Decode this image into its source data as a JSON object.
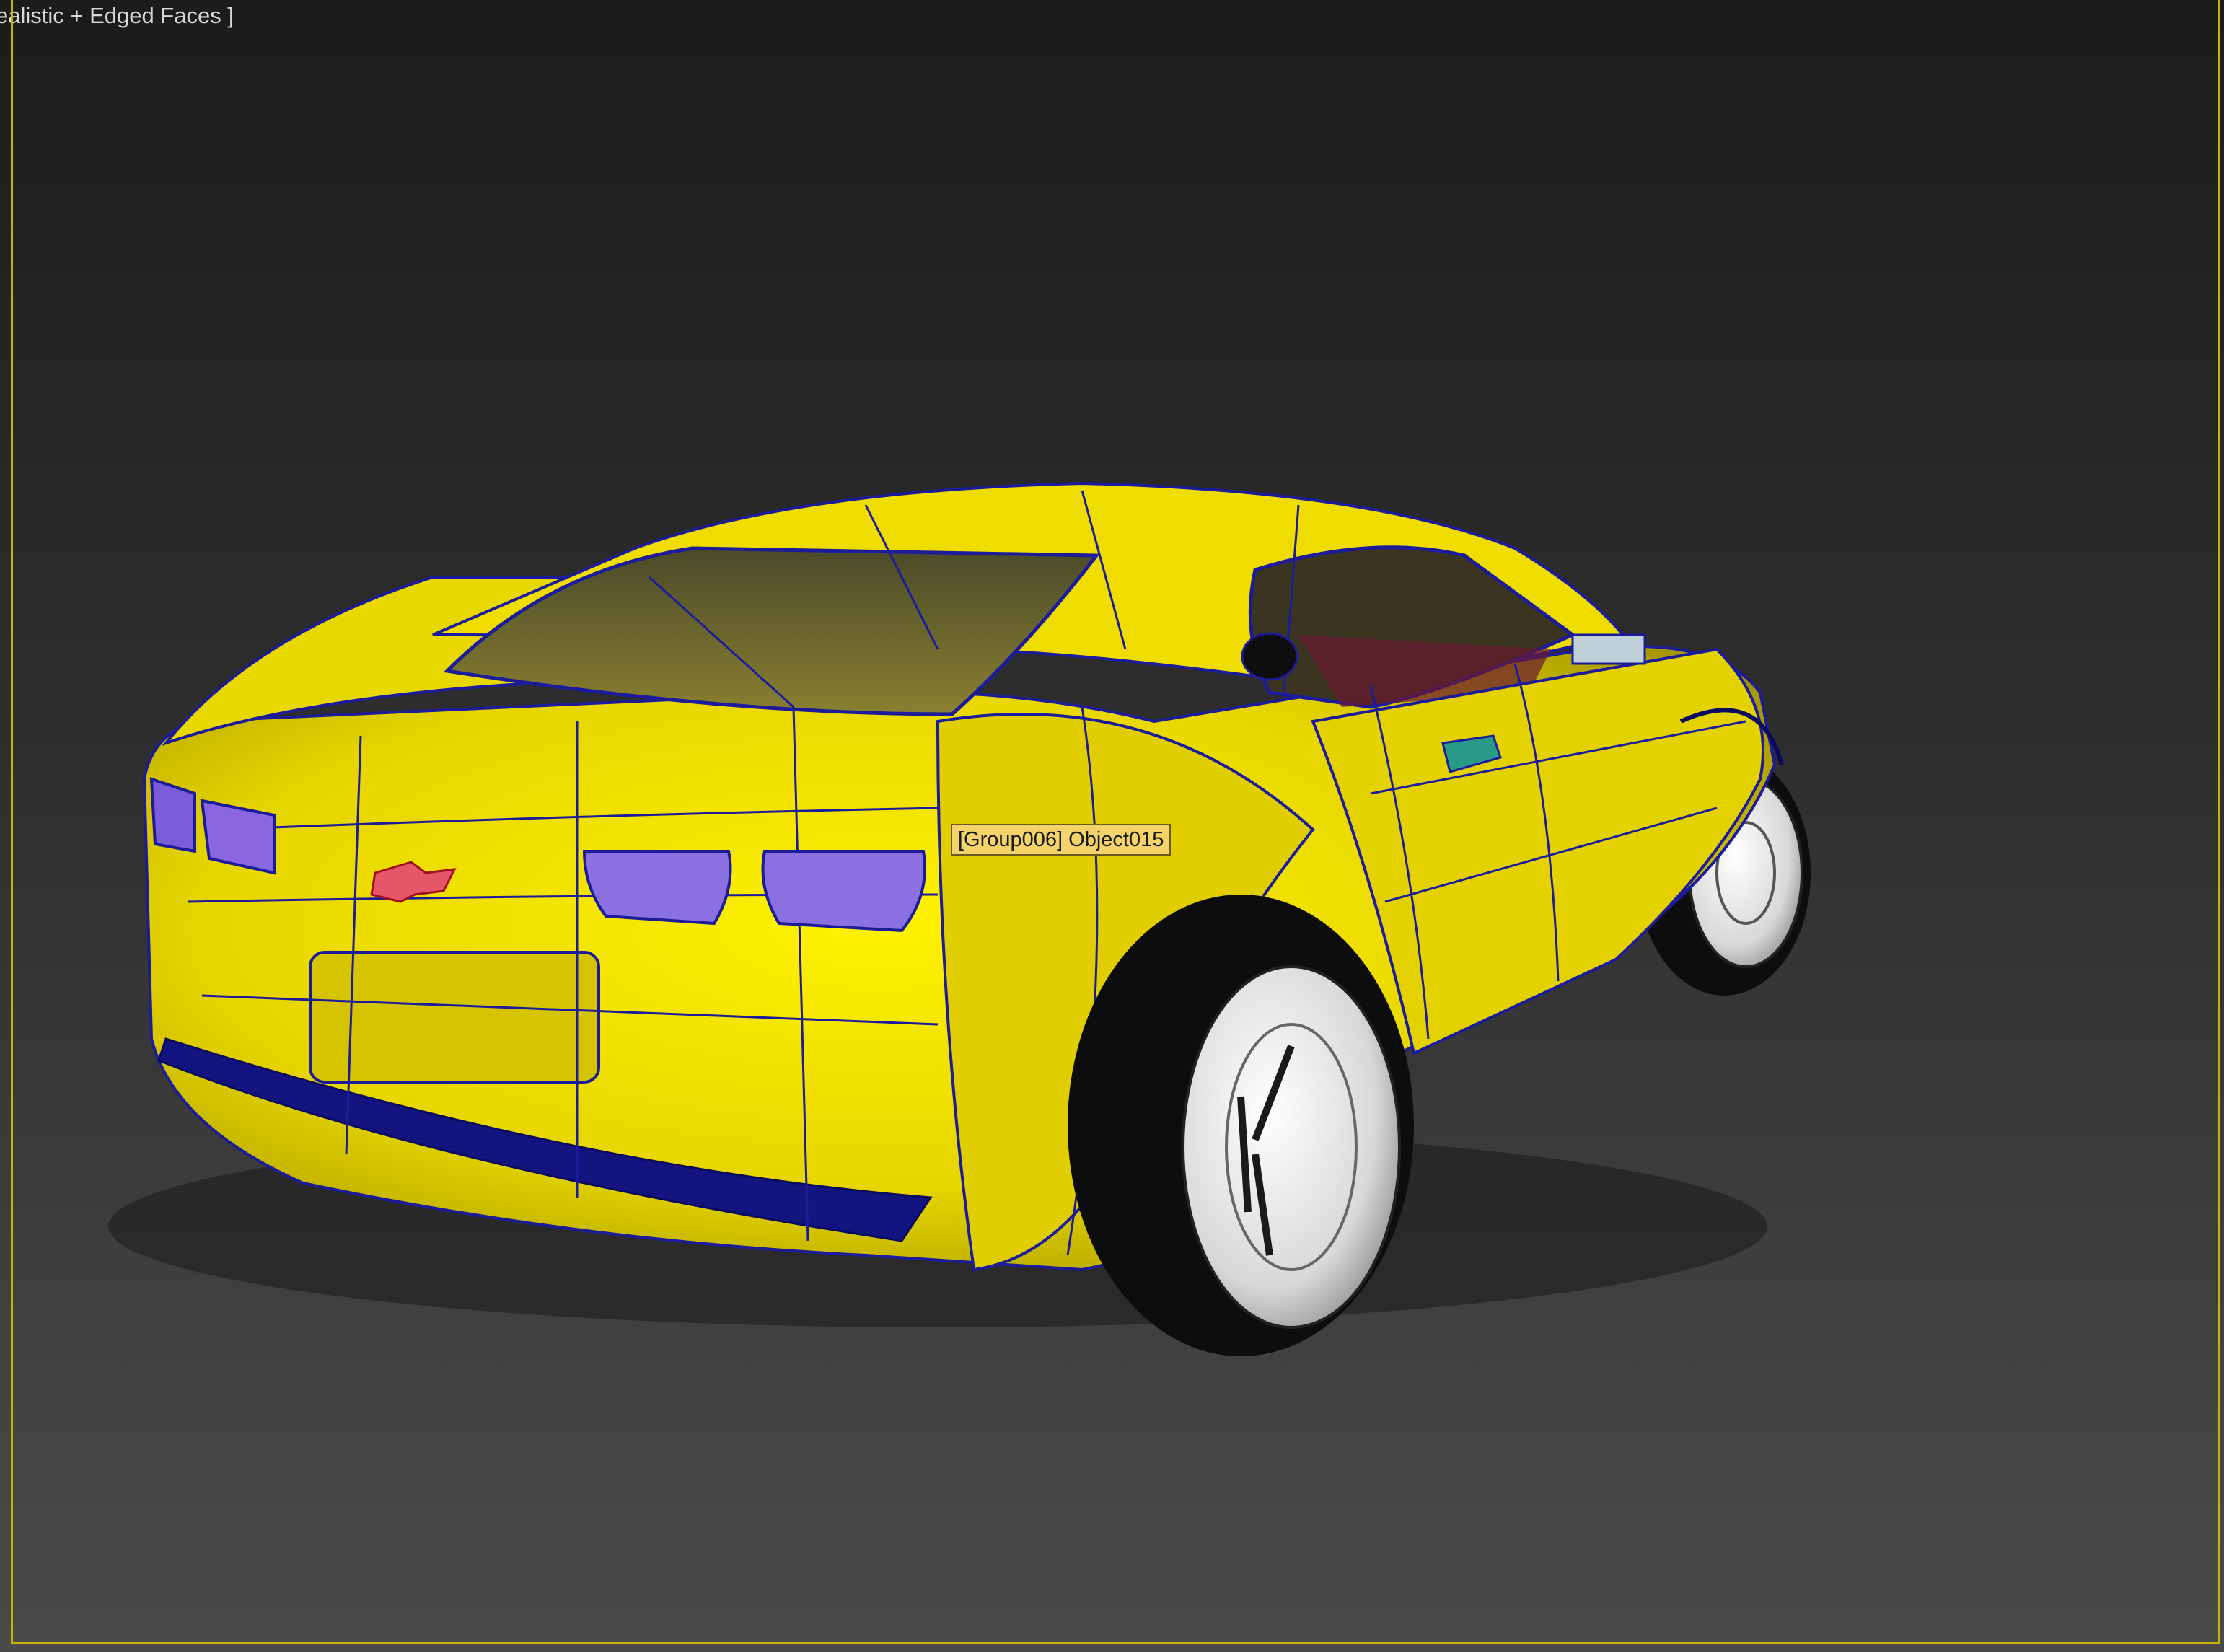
{
  "viewport": {
    "shading_label": "ealistic + Edged Faces ]",
    "hover_tooltip": "[Group006] Object015"
  },
  "colors": {
    "frame": "#c8b400",
    "body": "#e6d500",
    "wire": "#1c1c9a",
    "tooltip_bg": "#f3d36a"
  },
  "scene": {
    "object": "yellow sports car, rear three-quarter view, edged-faces wireframe"
  }
}
